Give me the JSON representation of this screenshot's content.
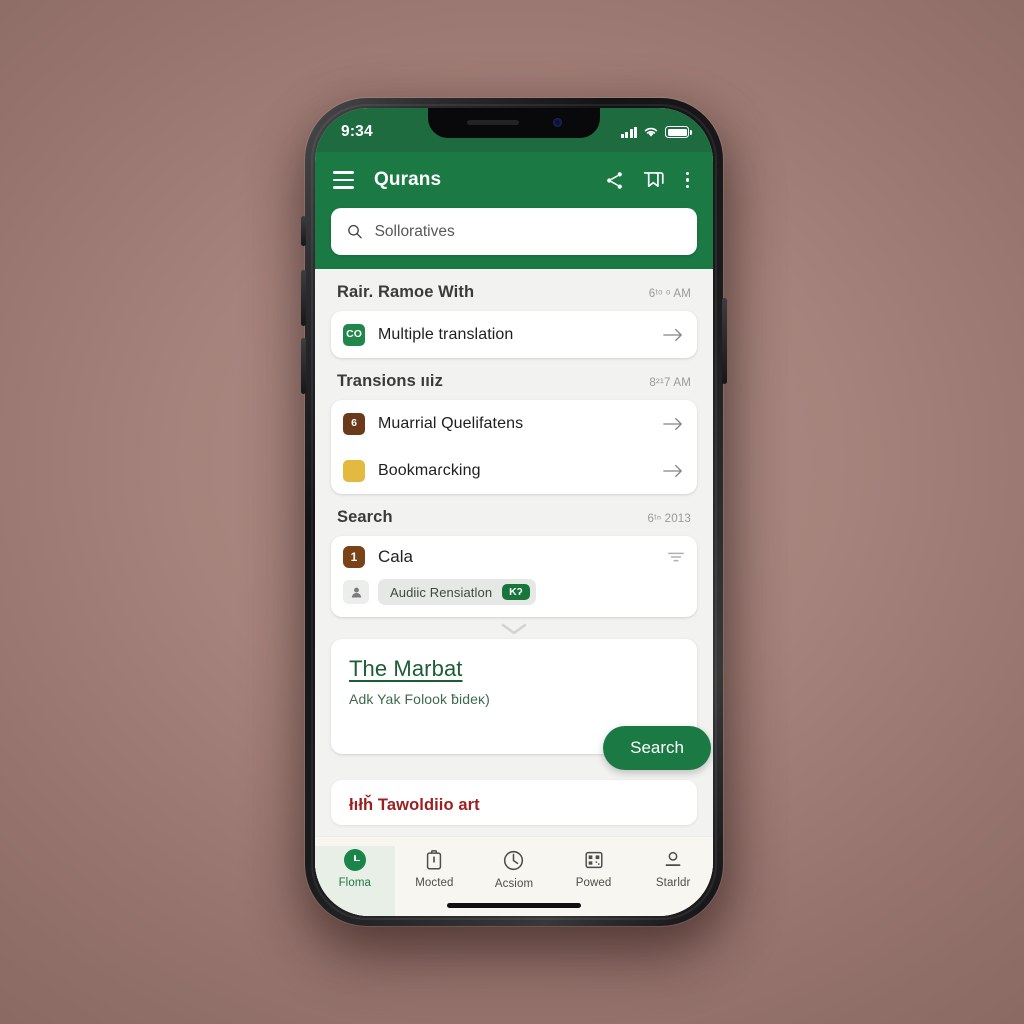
{
  "status_bar": {
    "time": "9:34",
    "signal_icon": "cellular-signal-icon",
    "wifi_icon": "wifi-icon",
    "battery_icon": "battery-icon"
  },
  "app_bar": {
    "menu_icon": "hamburger-menu-icon",
    "title": "Qurans",
    "share_icon": "share-icon",
    "bookmark_icon": "bookmark-heart-icon",
    "overflow_icon": "more-vertical-icon"
  },
  "search": {
    "icon": "search-icon",
    "value": "",
    "placeholder": "Solloratives"
  },
  "sections": [
    {
      "title": "Rair. Ramoe With",
      "time": "6ᵗᵒ ᵒ AM",
      "rows": [
        {
          "tile": "CO",
          "tile_style": "green",
          "icon_name": "translation-tile-icon",
          "label": "Multiple translation",
          "arrow": "arrow-right-icon"
        }
      ]
    },
    {
      "title": "Transions ııiz",
      "time": "8²¹7 AM",
      "rows": [
        {
          "tile": "6",
          "tile_style": "brown",
          "icon_name": "qualification-tile-icon",
          "label": "Muarrial Quelifatens",
          "arrow": "arrow-right-icon"
        },
        {
          "tile": "",
          "tile_style": "gold",
          "icon_name": "bookmark-tile-icon",
          "label": "Bookmaɾcking",
          "arrow": "arrow-right-icon"
        }
      ]
    }
  ],
  "search_section": {
    "title": "Search",
    "time": "6ᵗⁿ 2013",
    "result": {
      "badge": "1",
      "title": "Cala",
      "filter_icon": "filter-icon",
      "avatar_icon": "person-avatar-icon",
      "chip_text": "Audiic Rensiatlon",
      "chip_badge": "Kʔ"
    },
    "expand_icon": "chevron-down-icon"
  },
  "detail_card": {
    "title": "The Marbat",
    "subtitle": "Adk Yak Folook ƀideĸ)",
    "cta_label": "Search"
  },
  "peek_card": {
    "title": "łıłȟ Tawoldiio art"
  },
  "bottom_nav": [
    {
      "icon": "home-clock-icon",
      "label": "Floma",
      "active": true
    },
    {
      "icon": "clipboard-icon",
      "label": "Mocted",
      "active": false
    },
    {
      "icon": "clock-icon",
      "label": "Acsiom",
      "active": false
    },
    {
      "icon": "qr-code-icon",
      "label": "Powed",
      "active": false
    },
    {
      "icon": "person-icon",
      "label": "Starldr",
      "active": false
    }
  ],
  "colors": {
    "brand_green": "#1b7a43",
    "status_green": "#1d6b3f",
    "detail_green": "#1b5e36",
    "accent_brown": "#7a4317",
    "accent_gold": "#e3b93f",
    "peek_red": "#9c2020",
    "background": "#a6837c"
  }
}
